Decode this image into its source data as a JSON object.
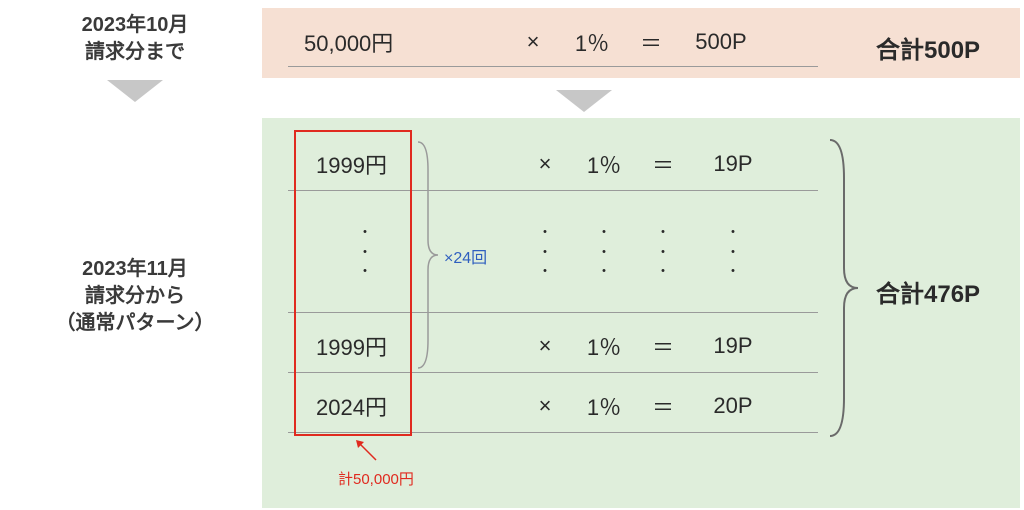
{
  "labels": {
    "topPeriod": "2023年10月\n請求分まで",
    "bottomPeriod": "2023年11月\n請求分から\n（通常パターン）"
  },
  "topCalc": {
    "amount": "50,000円",
    "op": "×",
    "rate": "1％",
    "eq": "＝",
    "points": "500P",
    "total": "合計500P"
  },
  "bottom": {
    "rows": [
      {
        "amount": "1999円",
        "op": "×",
        "rate": "1％",
        "eq": "＝",
        "points": "19P"
      },
      {
        "amount": "1999円",
        "op": "×",
        "rate": "1％",
        "eq": "＝",
        "points": "19P"
      },
      {
        "amount": "2024円",
        "op": "×",
        "rate": "1％",
        "eq": "＝",
        "points": "20P"
      }
    ],
    "repeatNote": "×24回",
    "sumNote": "計50,000円",
    "total": "合計476P"
  },
  "dot": "・"
}
